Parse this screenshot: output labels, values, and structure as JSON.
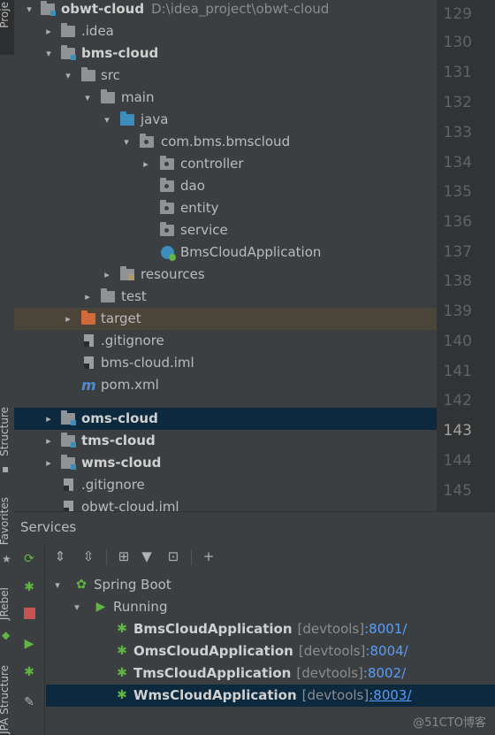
{
  "side_stripe": {
    "project_label": "Proje",
    "structure_label": "Structure",
    "favorites_label": "Favorites",
    "jrebel_label": "JRebel",
    "jpa_label": "JPA Structure"
  },
  "tree": [
    {
      "label": "obwt-cloud",
      "path": "D:\\idea_project\\obwt-cloud",
      "icon": "module-folder-icon",
      "arrow": "▾",
      "bold": true
    },
    {
      "label": ".idea",
      "icon": "folder-icon",
      "arrow": "▸"
    },
    {
      "label": "bms-cloud",
      "icon": "module-folder-icon",
      "arrow": "▾",
      "bold": true
    },
    {
      "label": "src",
      "icon": "folder-icon",
      "arrow": "▾"
    },
    {
      "label": "main",
      "icon": "folder-icon",
      "arrow": "▾"
    },
    {
      "label": "java",
      "icon": "source-folder-icon",
      "arrow": "▾"
    },
    {
      "label": "com.bms.bmscloud",
      "icon": "package-icon",
      "arrow": "▾"
    },
    {
      "label": "controller",
      "icon": "package-icon",
      "arrow": "▸"
    },
    {
      "label": "dao",
      "icon": "package-icon",
      "arrow": ""
    },
    {
      "label": "entity",
      "icon": "package-icon",
      "arrow": ""
    },
    {
      "label": "service",
      "icon": "package-icon",
      "arrow": ""
    },
    {
      "label": "BmsCloudApplication",
      "icon": "spring-app-icon",
      "arrow": ""
    },
    {
      "label": "resources",
      "icon": "resources-folder-icon",
      "arrow": "▸"
    },
    {
      "label": "test",
      "icon": "folder-icon",
      "arrow": "▸"
    },
    {
      "label": "target",
      "icon": "excluded-folder-icon",
      "arrow": "▸"
    },
    {
      "label": ".gitignore",
      "icon": "file-icon",
      "arrow": ""
    },
    {
      "label": "bms-cloud.iml",
      "icon": "file-icon",
      "arrow": ""
    },
    {
      "label": "pom.xml",
      "icon": "maven-icon",
      "arrow": ""
    },
    {
      "label": "oms-cloud",
      "icon": "module-folder-icon",
      "arrow": "▸",
      "bold": true
    },
    {
      "label": "tms-cloud",
      "icon": "module-folder-icon",
      "arrow": "▸",
      "bold": true
    },
    {
      "label": "wms-cloud",
      "icon": "module-folder-icon",
      "arrow": "▸",
      "bold": true
    },
    {
      "label": ".gitignore",
      "icon": "file-icon",
      "arrow": ""
    },
    {
      "label": "obwt-cloud.iml",
      "icon": "file-icon",
      "arrow": ""
    }
  ],
  "line_numbers": [
    "129",
    "130",
    "131",
    "132",
    "133",
    "134",
    "135",
    "136",
    "137",
    "138",
    "139",
    "140",
    "141",
    "142",
    "143",
    "144",
    "145"
  ],
  "services": {
    "title": "Services",
    "spring_boot": "Spring Boot",
    "running": "Running",
    "apps": [
      {
        "name": "BmsCloudApplication",
        "devtools": "[devtools]",
        "port": ":8001/"
      },
      {
        "name": "OmsCloudApplication",
        "devtools": "[devtools]",
        "port": ":8004/"
      },
      {
        "name": "TmsCloudApplication",
        "devtools": "[devtools]",
        "port": ":8002/"
      },
      {
        "name": "WmsCloudApplication",
        "devtools": "[devtools]",
        "port": ":8003/"
      }
    ]
  },
  "watermark": "@51CTO博客",
  "colors": {
    "selection": "#0d293e",
    "highlight": "#4b4438",
    "accent": "#589df6",
    "run_green": "#62b543"
  }
}
